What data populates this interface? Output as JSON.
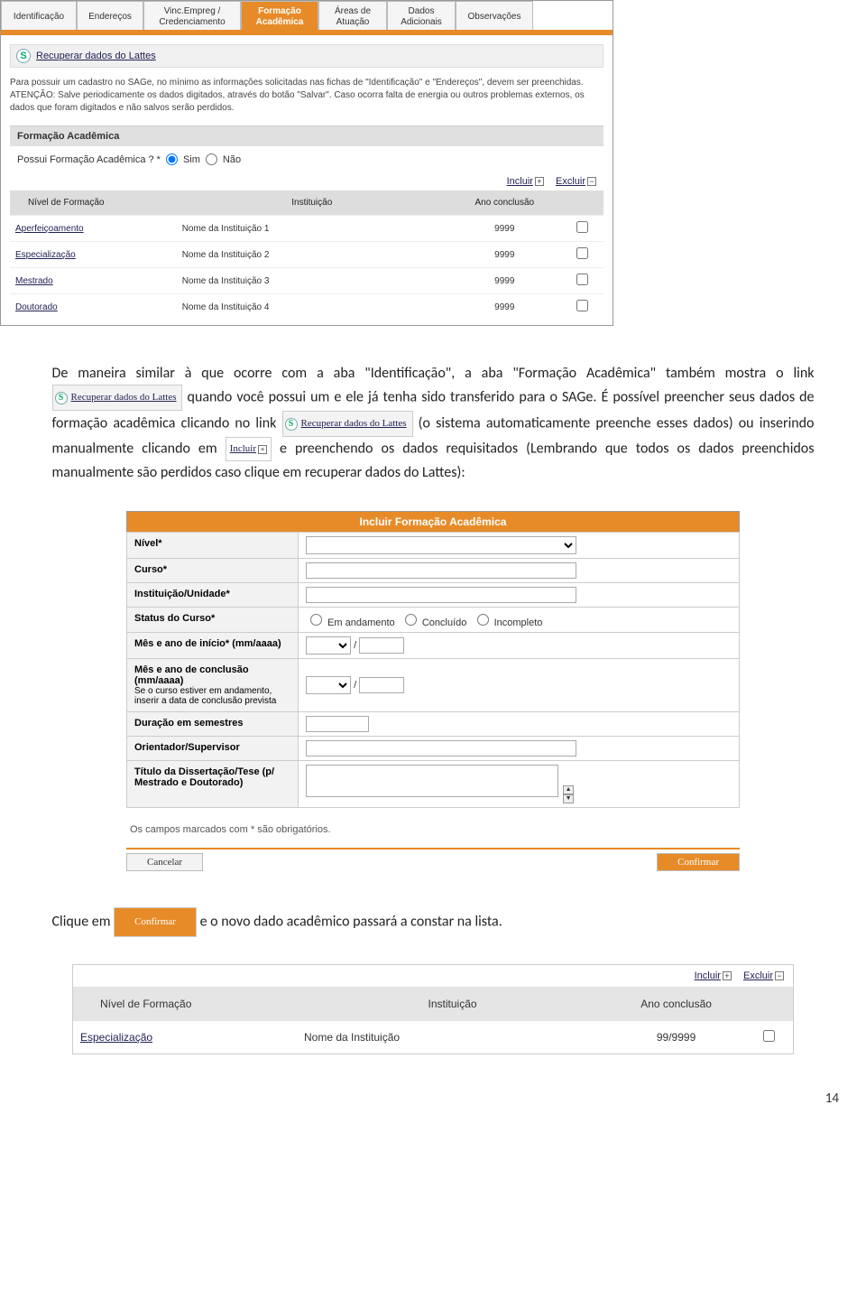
{
  "tabs": [
    "Identificação",
    "Endereços",
    "Vinc.Empreg / Credenciamento",
    "Formação Acadêmica",
    "Áreas de Atuação",
    "Dados Adicionais",
    "Observações"
  ],
  "active_tab": 3,
  "recuperar_link": "Recuperar dados do Lattes",
  "info_text": "Para possuir um cadastro no SAGe, no mínimo as informações solicitadas nas fichas de \"Identificação\" e \"Endereços\", devem ser preenchidas.\nATENÇÃO: Salve periodicamente os dados digitados, através do botão \"Salvar\". Caso ocorra falta de energia ou outros problemas externos, os dados que foram digitados e não salvos serão perdidos.",
  "section_title": "Formação Acadêmica",
  "radio_question": "Possui Formação Acadêmica ? *",
  "radio_yes": "Sim",
  "radio_no": "Não",
  "incluir_label": "Incluir",
  "excluir_label": "Excluir",
  "table1_headers": [
    "Nível de Formação",
    "Instituição",
    "Ano conclusão",
    ""
  ],
  "table1_rows": [
    {
      "nivel": "Aperfeiçoamento",
      "inst": "Nome da Instituição 1",
      "ano": "9999"
    },
    {
      "nivel": "Especialização",
      "inst": "Nome da Instituição 2",
      "ano": "9999"
    },
    {
      "nivel": "Mestrado",
      "inst": "Nome da Instituição 3",
      "ano": "9999"
    },
    {
      "nivel": "Doutorado",
      "inst": "Nome da Instituição 4",
      "ano": "9999"
    }
  ],
  "para1a": "De maneira similar à que ocorre com a aba \"Identificação\", a aba \"Formação Acadêmica\" também mostra o link ",
  "para1b": " quando você possui um e ele já tenha sido transferido para o SAGe. É possível preencher seus dados de formação acadêmica clicando no link ",
  "para1c": " (o sistema automaticamente preenche esses dados) ou inserindo manualmente clicando em ",
  "para1d": " e preenchendo os dados requisitados (Lembrando que todos os dados preenchidos manualmente são perdidos caso clique em recuperar dados do Lattes):",
  "form": {
    "title": "Incluir Formação Acadêmica",
    "nivel": "Nível*",
    "curso": "Curso*",
    "inst": "Instituição/Unidade*",
    "status": "Status do Curso*",
    "status_opts": [
      "Em andamento",
      "Concluído",
      "Incompleto"
    ],
    "inicio": "Mês e ano de início* (mm/aaaa)",
    "conclusao": "Mês e ano de conclusão (mm/aaaa)",
    "conclusao_sub": "Se o curso estiver em andamento, inserir a data de conclusão prevista",
    "duracao": "Duração em semestres",
    "orientador": "Orientador/Supervisor",
    "titulo": "Título da Dissertação/Tese (p/ Mestrado e Doutorado)",
    "slash": "/",
    "req_note": "Os campos marcados com * são obrigatórios.",
    "cancelar": "Cancelar",
    "confirmar": "Confirmar"
  },
  "para2a": "Clique em ",
  "para2b": " e o novo dado acadêmico passará a constar na lista.",
  "table3_headers": [
    "Nível de Formação",
    "Instituição",
    "Ano conclusão",
    ""
  ],
  "table3_row": {
    "nivel": "Especialização",
    "inst": "Nome da Instituição",
    "ano": "99/9999"
  },
  "page_number": "14"
}
